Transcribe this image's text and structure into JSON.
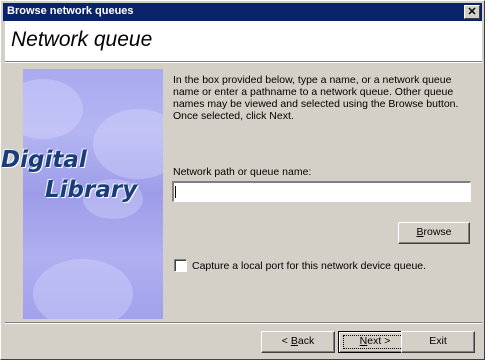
{
  "window": {
    "title": "Browse network queues",
    "close_glyph": "✕"
  },
  "header": {
    "title": "Network queue"
  },
  "sidebar": {
    "logo_line1": "Digital",
    "logo_line2": "Library"
  },
  "content": {
    "description": "In the box provided below, type a name, or a network queue name or enter a pathname to a network queue. Other queue names may be viewed and selected using the Browse button. Once selected, click Next.",
    "path_label": "Network path or queue name:",
    "path_value": "",
    "browse_label_prefix": "",
    "browse_label_hotkey": "B",
    "browse_label_rest": "rowse",
    "capture_label": "Capture a local port for this network device queue.",
    "capture_checked": false
  },
  "footer": {
    "back_prefix": "< ",
    "back_hotkey": "B",
    "back_rest": "ack",
    "next_hotkey": "N",
    "next_rest": "ext >",
    "exit_label": "Exit"
  },
  "colors": {
    "titlebar": "#0a246a",
    "dialog": "#d4d0c8",
    "logo": "#1a3d7a",
    "sidebar": "#a9aaf0"
  },
  "icons": [
    "close-icon"
  ]
}
